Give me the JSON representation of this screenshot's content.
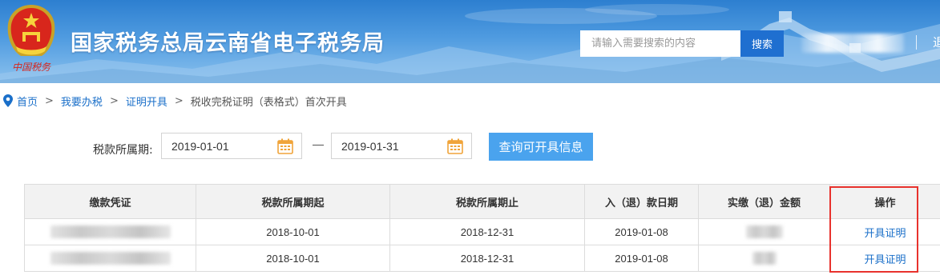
{
  "colors": {
    "brand_blue": "#2d7fd0",
    "link_blue": "#1a6fc9",
    "query_button": "#4aa3ee",
    "highlight_red": "#e8322d"
  },
  "header": {
    "title": "国家税务总局云南省电子税务局",
    "emblem_motto": "中国税务",
    "search": {
      "placeholder": "请输入需要搜索的内容",
      "button_label": "搜索"
    },
    "right_link": "退"
  },
  "breadcrumb": {
    "icon": "location-pin-icon",
    "items": [
      "首页",
      "我要办税",
      "证明开具"
    ],
    "separator": ">",
    "current": "税收完税证明（表格式）首次开具"
  },
  "query_form": {
    "period_label": "税款所属期:",
    "start_date": "2019-01-01",
    "end_date": "2019-01-31",
    "calendar_icon": "calendar-icon",
    "query_button": "查询可开具信息"
  },
  "table": {
    "columns": [
      "缴款凭证",
      "税款所属期起",
      "税款所属期止",
      "入（退）款日期",
      "实缴（退）金额",
      "操作"
    ],
    "rows": [
      {
        "period_start": "2018-10-01",
        "period_end": "2018-12-31",
        "payment_date": "2019-01-08",
        "action": "开具证明"
      },
      {
        "period_start": "2018-10-01",
        "period_end": "2018-12-31",
        "payment_date": "2019-01-08",
        "action": "开具证明"
      }
    ]
  }
}
